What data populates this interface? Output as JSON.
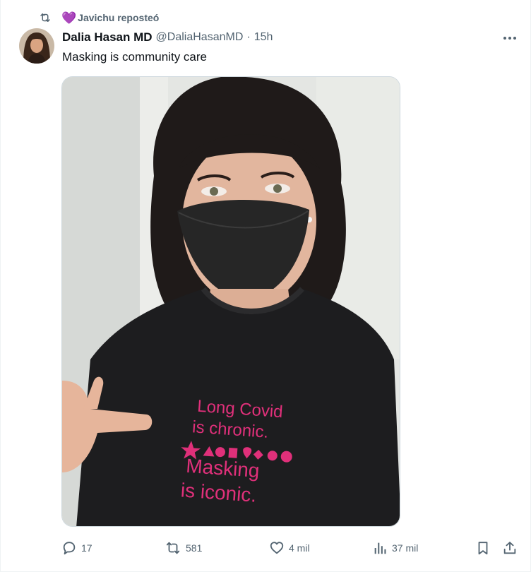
{
  "repost": {
    "label": "Javichu reposteó",
    "icon": "repost-icon",
    "heart": "heart-emoji"
  },
  "tweet": {
    "author_name": "Dalia Hasan MD",
    "handle": "@DaliaHasanMD",
    "separator": "·",
    "time": "15h",
    "text": "Masking is community care",
    "media": {
      "shirt_text": [
        "Long Covid",
        "is chronic.",
        "Masking",
        "is iconic."
      ]
    }
  },
  "actions": {
    "replies": "17",
    "reposts": "581",
    "likes": "4 mil",
    "views": "37 mil"
  },
  "colors": {
    "secondary_text": "#536471",
    "primary_text": "#0f1419",
    "heart": "#a57ad1",
    "shirt_text": "#e0307a"
  }
}
